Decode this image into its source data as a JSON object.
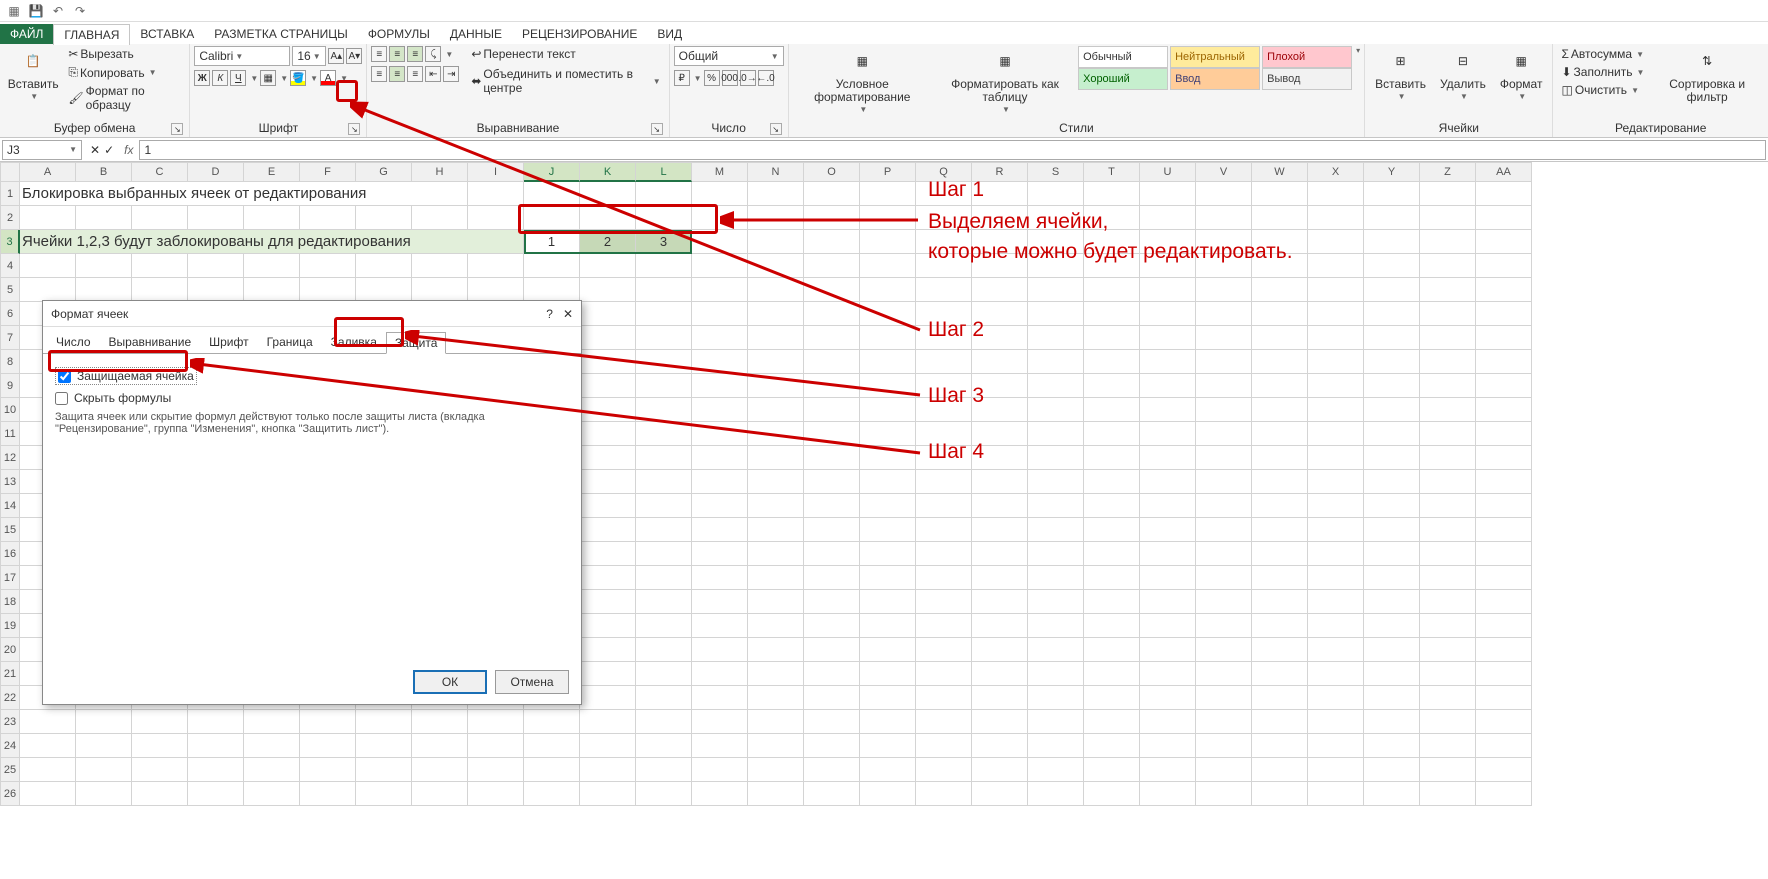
{
  "qat": {
    "save": "💾",
    "undo": "↶",
    "redo": "↷"
  },
  "tabs": {
    "file": "ФАЙЛ",
    "home": "ГЛАВНАЯ",
    "insert": "ВСТАВКА",
    "layout": "РАЗМЕТКА СТРАНИЦЫ",
    "formulas": "ФОРМУЛЫ",
    "data": "ДАННЫЕ",
    "review": "РЕЦЕНЗИРОВАНИЕ",
    "view": "ВИД"
  },
  "clipboard": {
    "paste": "Вставить",
    "cut": "Вырезать",
    "copy": "Копировать",
    "formatpainter": "Формат по образцу",
    "group": "Буфер обмена"
  },
  "font": {
    "name": "Calibri",
    "size": "16",
    "bold": "Ж",
    "italic": "К",
    "underline": "Ч",
    "group": "Шрифт"
  },
  "align": {
    "wrap": "Перенести текст",
    "merge": "Объединить и поместить в центре",
    "group": "Выравнивание"
  },
  "number": {
    "format": "Общий",
    "group": "Число"
  },
  "styles": {
    "cond": "Условное форматирование",
    "table": "Форматировать как таблицу",
    "normal": "Обычный",
    "neutral": "Нейтральный",
    "bad": "Плохой",
    "good": "Хороший",
    "input": "Ввод",
    "output": "Вывод",
    "group": "Стили"
  },
  "cells": {
    "insert": "Вставить",
    "delete": "Удалить",
    "format": "Формат",
    "group": "Ячейки"
  },
  "editing": {
    "sum": "Автосумма",
    "fill": "Заполнить",
    "clear": "Очистить",
    "sort": "Сортировка и фильтр",
    "group": "Редактирование"
  },
  "namebox": "J3",
  "formula": "1",
  "columns": [
    "A",
    "B",
    "C",
    "D",
    "E",
    "F",
    "G",
    "H",
    "I",
    "J",
    "K",
    "L",
    "M",
    "N",
    "O",
    "P",
    "Q",
    "R",
    "S",
    "T",
    "U",
    "V",
    "W",
    "X",
    "Y",
    "Z",
    "AA"
  ],
  "content": {
    "row1": "Блокировка выбранных ячеек от редактирования",
    "row3": "Ячейки 1,2,3 будут заблокированы для редактирования",
    "j3": "1",
    "k3": "2",
    "l3": "3"
  },
  "annotations": {
    "step1": "Шаг 1",
    "step1a": "Выделяем ячейки,",
    "step1b": "которые можно будет редактировать.",
    "step2": "Шаг 2",
    "step3": "Шаг 3",
    "step4": "Шаг 4"
  },
  "dialog": {
    "title": "Формат ячеек",
    "help": "?",
    "close": "✕",
    "tabs": {
      "number": "Число",
      "align": "Выравнивание",
      "font": "Шрифт",
      "border": "Граница",
      "fill": "Заливка",
      "protect": "Защита"
    },
    "chk1": "Защищаемая ячейка",
    "chk2": "Скрыть формулы",
    "hint": "Защита ячеек или скрытие формул действуют только после защиты листа (вкладка \"Рецензирование\", группа \"Изменения\", кнопка \"Защитить лист\").",
    "ok": "ОК",
    "cancel": "Отмена"
  }
}
